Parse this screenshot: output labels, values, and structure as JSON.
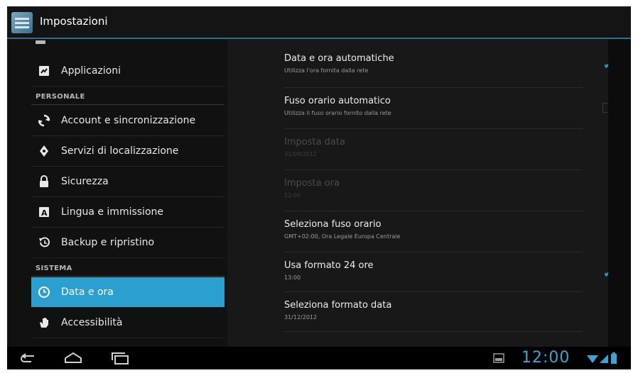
{
  "actionbar": {
    "title": "Impostazioni",
    "icon": "settings-app-icon"
  },
  "sidebar": {
    "items": [
      {
        "label": "Applicazioni",
        "icon": "apps-icon"
      },
      {
        "label": "Account e sincronizzazione",
        "icon": "sync-icon"
      },
      {
        "label": "Servizi di localizzazione",
        "icon": "location-icon"
      },
      {
        "label": "Sicurezza",
        "icon": "lock-icon"
      },
      {
        "label": "Lingua e immissione",
        "icon": "keyboard-icon"
      },
      {
        "label": "Backup e ripristino",
        "icon": "backup-icon"
      },
      {
        "label": "Data e ora",
        "icon": "clock-icon",
        "selected": true
      },
      {
        "label": "Accessibilità",
        "icon": "hand-icon"
      }
    ],
    "sections": {
      "personal": "PERSONALE",
      "system": "SISTEMA"
    }
  },
  "settings": [
    {
      "title": "Data e ora automatiche",
      "summary": "Utilizza l'ora fornita dalla rete",
      "checked": true
    },
    {
      "title": "Fuso orario automatico",
      "summary": "Utilizza il fuso orario fornito dalla rete",
      "checked": false
    },
    {
      "title": "Imposta data",
      "summary": "31/09/2012",
      "disabled": true
    },
    {
      "title": "Imposta ora",
      "summary": "12:00",
      "disabled": true
    },
    {
      "title": "Seleziona fuso orario",
      "summary": "GMT+02:00, Ora Legale Europa Centrale"
    },
    {
      "title": "Usa formato 24 ore",
      "summary": "13:00",
      "checked": true
    },
    {
      "title": "Seleziona formato data",
      "summary": "31/12/2012"
    }
  ],
  "statusbar": {
    "clock": "12:00"
  },
  "colors": {
    "accent": "#2a9fd0",
    "background": "#111111",
    "text": "#e8e8e8"
  }
}
